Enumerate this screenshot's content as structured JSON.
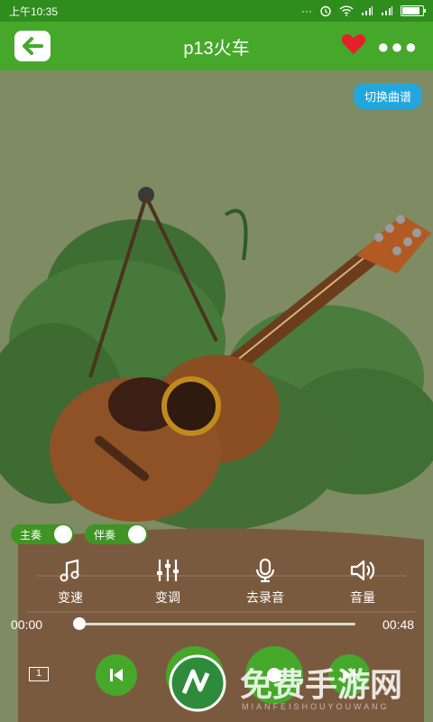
{
  "statusbar": {
    "time": "上午10:35",
    "signal_text": "···"
  },
  "header": {
    "title": "p13火车"
  },
  "switch_score_label": "切换曲谱",
  "toggles": [
    {
      "label": "主奏"
    },
    {
      "label": "伴奏"
    }
  ],
  "controls": [
    {
      "label": "变速",
      "icon": "music-note-icon"
    },
    {
      "label": "变调",
      "icon": "sliders-icon"
    },
    {
      "label": "去录音",
      "icon": "microphone-icon"
    },
    {
      "label": "音量",
      "icon": "volume-icon"
    }
  ],
  "progress": {
    "current": "00:00",
    "total": "00:48",
    "fraction": 0.0
  },
  "bottom": {
    "loop_mode": "1"
  },
  "watermark": {
    "main": "免费手游网",
    "sub": "MIANFEISHOUYOUWANG"
  },
  "colors": {
    "header": "#46a82b",
    "statusbar": "#2f8d1d",
    "accent_blue": "#22a6dc",
    "background": "#7e8b63",
    "heart": "#e4212b"
  }
}
